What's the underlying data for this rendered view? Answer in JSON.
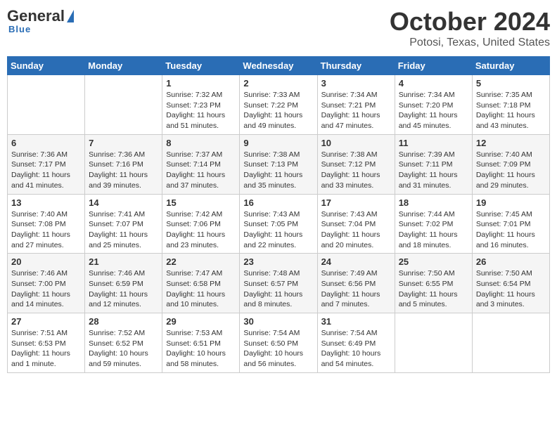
{
  "header": {
    "logo_general": "General",
    "logo_blue": "Blue",
    "title": "October 2024",
    "location": "Potosi, Texas, United States"
  },
  "weekdays": [
    "Sunday",
    "Monday",
    "Tuesday",
    "Wednesday",
    "Thursday",
    "Friday",
    "Saturday"
  ],
  "weeks": [
    [
      {
        "day": "",
        "sunrise": "",
        "sunset": "",
        "daylight": ""
      },
      {
        "day": "",
        "sunrise": "",
        "sunset": "",
        "daylight": ""
      },
      {
        "day": "1",
        "sunrise": "Sunrise: 7:32 AM",
        "sunset": "Sunset: 7:23 PM",
        "daylight": "Daylight: 11 hours and 51 minutes."
      },
      {
        "day": "2",
        "sunrise": "Sunrise: 7:33 AM",
        "sunset": "Sunset: 7:22 PM",
        "daylight": "Daylight: 11 hours and 49 minutes."
      },
      {
        "day": "3",
        "sunrise": "Sunrise: 7:34 AM",
        "sunset": "Sunset: 7:21 PM",
        "daylight": "Daylight: 11 hours and 47 minutes."
      },
      {
        "day": "4",
        "sunrise": "Sunrise: 7:34 AM",
        "sunset": "Sunset: 7:20 PM",
        "daylight": "Daylight: 11 hours and 45 minutes."
      },
      {
        "day": "5",
        "sunrise": "Sunrise: 7:35 AM",
        "sunset": "Sunset: 7:18 PM",
        "daylight": "Daylight: 11 hours and 43 minutes."
      }
    ],
    [
      {
        "day": "6",
        "sunrise": "Sunrise: 7:36 AM",
        "sunset": "Sunset: 7:17 PM",
        "daylight": "Daylight: 11 hours and 41 minutes."
      },
      {
        "day": "7",
        "sunrise": "Sunrise: 7:36 AM",
        "sunset": "Sunset: 7:16 PM",
        "daylight": "Daylight: 11 hours and 39 minutes."
      },
      {
        "day": "8",
        "sunrise": "Sunrise: 7:37 AM",
        "sunset": "Sunset: 7:14 PM",
        "daylight": "Daylight: 11 hours and 37 minutes."
      },
      {
        "day": "9",
        "sunrise": "Sunrise: 7:38 AM",
        "sunset": "Sunset: 7:13 PM",
        "daylight": "Daylight: 11 hours and 35 minutes."
      },
      {
        "day": "10",
        "sunrise": "Sunrise: 7:38 AM",
        "sunset": "Sunset: 7:12 PM",
        "daylight": "Daylight: 11 hours and 33 minutes."
      },
      {
        "day": "11",
        "sunrise": "Sunrise: 7:39 AM",
        "sunset": "Sunset: 7:11 PM",
        "daylight": "Daylight: 11 hours and 31 minutes."
      },
      {
        "day": "12",
        "sunrise": "Sunrise: 7:40 AM",
        "sunset": "Sunset: 7:09 PM",
        "daylight": "Daylight: 11 hours and 29 minutes."
      }
    ],
    [
      {
        "day": "13",
        "sunrise": "Sunrise: 7:40 AM",
        "sunset": "Sunset: 7:08 PM",
        "daylight": "Daylight: 11 hours and 27 minutes."
      },
      {
        "day": "14",
        "sunrise": "Sunrise: 7:41 AM",
        "sunset": "Sunset: 7:07 PM",
        "daylight": "Daylight: 11 hours and 25 minutes."
      },
      {
        "day": "15",
        "sunrise": "Sunrise: 7:42 AM",
        "sunset": "Sunset: 7:06 PM",
        "daylight": "Daylight: 11 hours and 23 minutes."
      },
      {
        "day": "16",
        "sunrise": "Sunrise: 7:43 AM",
        "sunset": "Sunset: 7:05 PM",
        "daylight": "Daylight: 11 hours and 22 minutes."
      },
      {
        "day": "17",
        "sunrise": "Sunrise: 7:43 AM",
        "sunset": "Sunset: 7:04 PM",
        "daylight": "Daylight: 11 hours and 20 minutes."
      },
      {
        "day": "18",
        "sunrise": "Sunrise: 7:44 AM",
        "sunset": "Sunset: 7:02 PM",
        "daylight": "Daylight: 11 hours and 18 minutes."
      },
      {
        "day": "19",
        "sunrise": "Sunrise: 7:45 AM",
        "sunset": "Sunset: 7:01 PM",
        "daylight": "Daylight: 11 hours and 16 minutes."
      }
    ],
    [
      {
        "day": "20",
        "sunrise": "Sunrise: 7:46 AM",
        "sunset": "Sunset: 7:00 PM",
        "daylight": "Daylight: 11 hours and 14 minutes."
      },
      {
        "day": "21",
        "sunrise": "Sunrise: 7:46 AM",
        "sunset": "Sunset: 6:59 PM",
        "daylight": "Daylight: 11 hours and 12 minutes."
      },
      {
        "day": "22",
        "sunrise": "Sunrise: 7:47 AM",
        "sunset": "Sunset: 6:58 PM",
        "daylight": "Daylight: 11 hours and 10 minutes."
      },
      {
        "day": "23",
        "sunrise": "Sunrise: 7:48 AM",
        "sunset": "Sunset: 6:57 PM",
        "daylight": "Daylight: 11 hours and 8 minutes."
      },
      {
        "day": "24",
        "sunrise": "Sunrise: 7:49 AM",
        "sunset": "Sunset: 6:56 PM",
        "daylight": "Daylight: 11 hours and 7 minutes."
      },
      {
        "day": "25",
        "sunrise": "Sunrise: 7:50 AM",
        "sunset": "Sunset: 6:55 PM",
        "daylight": "Daylight: 11 hours and 5 minutes."
      },
      {
        "day": "26",
        "sunrise": "Sunrise: 7:50 AM",
        "sunset": "Sunset: 6:54 PM",
        "daylight": "Daylight: 11 hours and 3 minutes."
      }
    ],
    [
      {
        "day": "27",
        "sunrise": "Sunrise: 7:51 AM",
        "sunset": "Sunset: 6:53 PM",
        "daylight": "Daylight: 11 hours and 1 minute."
      },
      {
        "day": "28",
        "sunrise": "Sunrise: 7:52 AM",
        "sunset": "Sunset: 6:52 PM",
        "daylight": "Daylight: 10 hours and 59 minutes."
      },
      {
        "day": "29",
        "sunrise": "Sunrise: 7:53 AM",
        "sunset": "Sunset: 6:51 PM",
        "daylight": "Daylight: 10 hours and 58 minutes."
      },
      {
        "day": "30",
        "sunrise": "Sunrise: 7:54 AM",
        "sunset": "Sunset: 6:50 PM",
        "daylight": "Daylight: 10 hours and 56 minutes."
      },
      {
        "day": "31",
        "sunrise": "Sunrise: 7:54 AM",
        "sunset": "Sunset: 6:49 PM",
        "daylight": "Daylight: 10 hours and 54 minutes."
      },
      {
        "day": "",
        "sunrise": "",
        "sunset": "",
        "daylight": ""
      },
      {
        "day": "",
        "sunrise": "",
        "sunset": "",
        "daylight": ""
      }
    ]
  ]
}
